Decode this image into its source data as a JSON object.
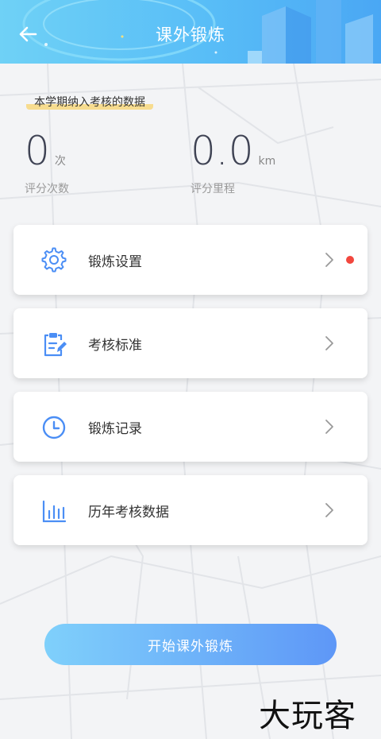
{
  "header": {
    "title": "课外锻炼"
  },
  "stats": {
    "section_label": "本学期纳入考核的数据",
    "count": {
      "value": "0",
      "unit": "次",
      "caption": "评分次数"
    },
    "distance": {
      "value": "0.0",
      "unit": "km",
      "caption": "评分里程"
    }
  },
  "menu": [
    {
      "label": "锻炼设置",
      "icon": "gear-icon",
      "has_badge": true
    },
    {
      "label": "考核标准",
      "icon": "clipboard-edit-icon",
      "has_badge": false
    },
    {
      "label": "锻炼记录",
      "icon": "clock-icon",
      "has_badge": false
    },
    {
      "label": "历年考核数据",
      "icon": "bar-chart-icon",
      "has_badge": false
    }
  ],
  "start_button": {
    "label": "开始课外锻炼"
  },
  "watermark": "大玩客",
  "colors": {
    "accent": "#4b8ef5",
    "badge": "#f2473e",
    "highlight": "#f7dc8f"
  }
}
